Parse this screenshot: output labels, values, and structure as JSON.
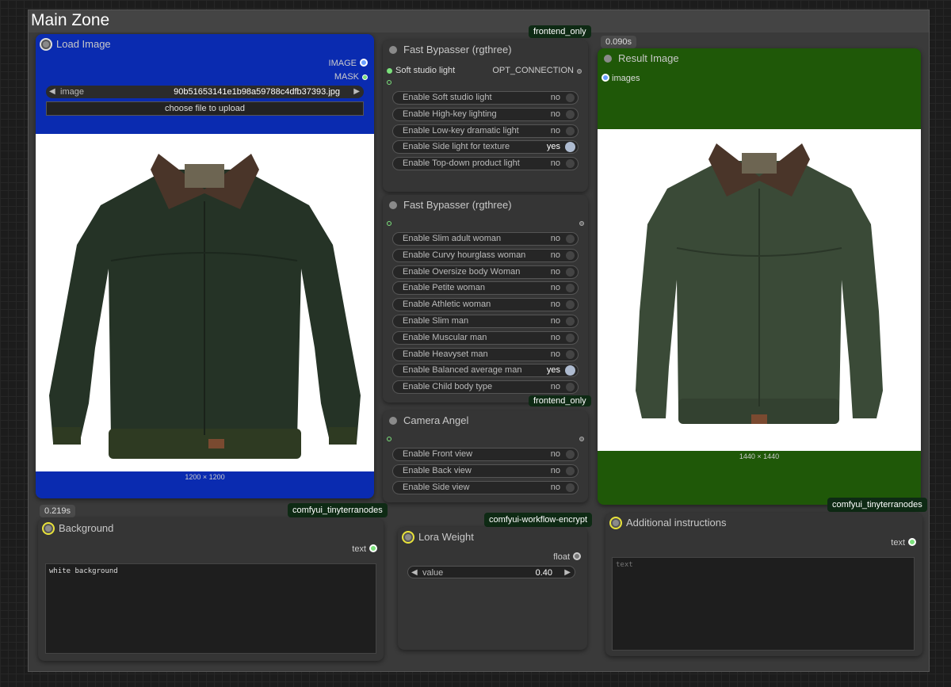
{
  "group": {
    "title": "Main Zone"
  },
  "badges": {
    "frontend_only_top": "frontend_only",
    "frontend_only_mid": "frontend_only",
    "result_time": "0.090s",
    "bg_time": "0.219s",
    "tinyterra_left": "comfyui_tinyterranodes",
    "tinyterra_right": "comfyui_tinyterranodes",
    "encrypt": "comfyui-workflow-encrypt"
  },
  "load_image": {
    "title": "Load Image",
    "out_image": "IMAGE",
    "out_mask": "MASK",
    "image_label": "image",
    "image_value": "90b51653141e1b98a59788c4dfb37393.jpg",
    "upload_label": "choose file to upload",
    "dims": "1200 × 1200",
    "color": "#0a2bb0"
  },
  "bypasser_lighting": {
    "title": "Fast Bypasser (rgthree)",
    "input_label": "Soft studio light",
    "output_label": "OPT_CONNECTION",
    "toggles": [
      {
        "label": "Enable Soft studio light",
        "value": "no",
        "on": false
      },
      {
        "label": "Enable High-key lighting",
        "value": "no",
        "on": false
      },
      {
        "label": "Enable Low-key dramatic light",
        "value": "no",
        "on": false
      },
      {
        "label": "Enable Side light for texture",
        "value": "yes",
        "on": true
      },
      {
        "label": "Enable Top-down product light",
        "value": "no",
        "on": false
      }
    ]
  },
  "bypasser_body": {
    "title": "Fast Bypasser (rgthree)",
    "toggles": [
      {
        "label": "Enable Slim adult woman",
        "value": "no",
        "on": false
      },
      {
        "label": "Enable Curvy hourglass woman",
        "value": "no",
        "on": false
      },
      {
        "label": "Enable Oversize body Woman",
        "value": "no",
        "on": false
      },
      {
        "label": "Enable Petite woman",
        "value": "no",
        "on": false
      },
      {
        "label": "Enable Athletic woman",
        "value": "no",
        "on": false
      },
      {
        "label": "Enable Slim man",
        "value": "no",
        "on": false
      },
      {
        "label": "Enable Muscular man",
        "value": "no",
        "on": false
      },
      {
        "label": "Enable Heavyset man",
        "value": "no",
        "on": false
      },
      {
        "label": "Enable Balanced average man",
        "value": "yes",
        "on": true
      },
      {
        "label": "Enable Child body type",
        "value": "no",
        "on": false
      }
    ]
  },
  "camera": {
    "title": "Camera Angel",
    "toggles": [
      {
        "label": "Enable Front view",
        "value": "no",
        "on": false
      },
      {
        "label": "Enable Back view",
        "value": "no",
        "on": false
      },
      {
        "label": "Enable Side view",
        "value": "no",
        "on": false
      }
    ]
  },
  "result": {
    "title": "Result Image",
    "input_label": "images",
    "dims": "1440 × 1440",
    "color": "#1f5808"
  },
  "background": {
    "title": "Background",
    "out_label": "text",
    "text": "white background"
  },
  "lora": {
    "title": "Lora Weight",
    "out_label": "float",
    "value_label": "value",
    "value": "0.40"
  },
  "additional": {
    "title": "Additional instructions",
    "out_label": "text",
    "placeholder": "text"
  }
}
